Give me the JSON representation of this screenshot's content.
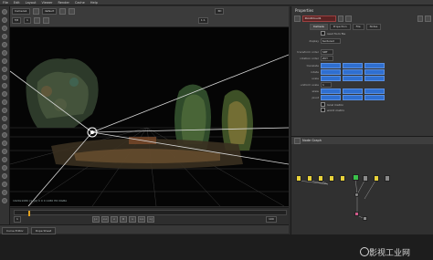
{
  "menu": [
    "File",
    "Edit",
    "Layout",
    "Viewer",
    "Render",
    "Cache",
    "Help"
  ],
  "viewer": {
    "camera_field": "Camera1",
    "viewer_field": "default",
    "mode_field": "3D",
    "frame_value": "1",
    "fstop_value": "f/8",
    "zoom_value": "1:1",
    "info_text": "1920x1080 (1.00) 0 0 0 1280 HD RGBA"
  },
  "timeline": {
    "playhead_percent": 5,
    "start_frame": "1",
    "end_frame": "100",
    "transport": [
      "|<",
      "<<",
      "<",
      "II",
      ">",
      ">>",
      ">|"
    ]
  },
  "bottom_tabs": [
    "Curve Editor",
    "Dope Sheet"
  ],
  "properties": {
    "title": "Properties",
    "node_name": "PointCloud1",
    "tabs": [
      "Camera",
      "Projection",
      "File",
      "Notes"
    ],
    "rows": [
      {
        "label": "read from file",
        "type": "check"
      },
      {
        "label": "display",
        "type": "field",
        "value": "textured"
      },
      {
        "label": "transform order",
        "type": "field",
        "value": "SRT"
      },
      {
        "label": "rotation order",
        "type": "field",
        "value": "ZXY"
      },
      {
        "label": "translate",
        "type": "bar"
      },
      {
        "label": "rotate",
        "type": "bar"
      },
      {
        "label": "scale",
        "type": "bar"
      },
      {
        "label": "uniform scale",
        "type": "field",
        "value": "1"
      },
      {
        "label": "skew",
        "type": "bar"
      },
      {
        "label": "pivot",
        "type": "bar"
      }
    ],
    "checks": [
      "local matrix",
      "world matrix"
    ]
  },
  "node_graph": {
    "title": "Node Graph",
    "colors": {
      "yellow": "#e8d23a",
      "green": "#3ac24a",
      "gray": "#8a8a8a",
      "pink": "#d05a8a"
    }
  },
  "watermark": "影视工业网"
}
